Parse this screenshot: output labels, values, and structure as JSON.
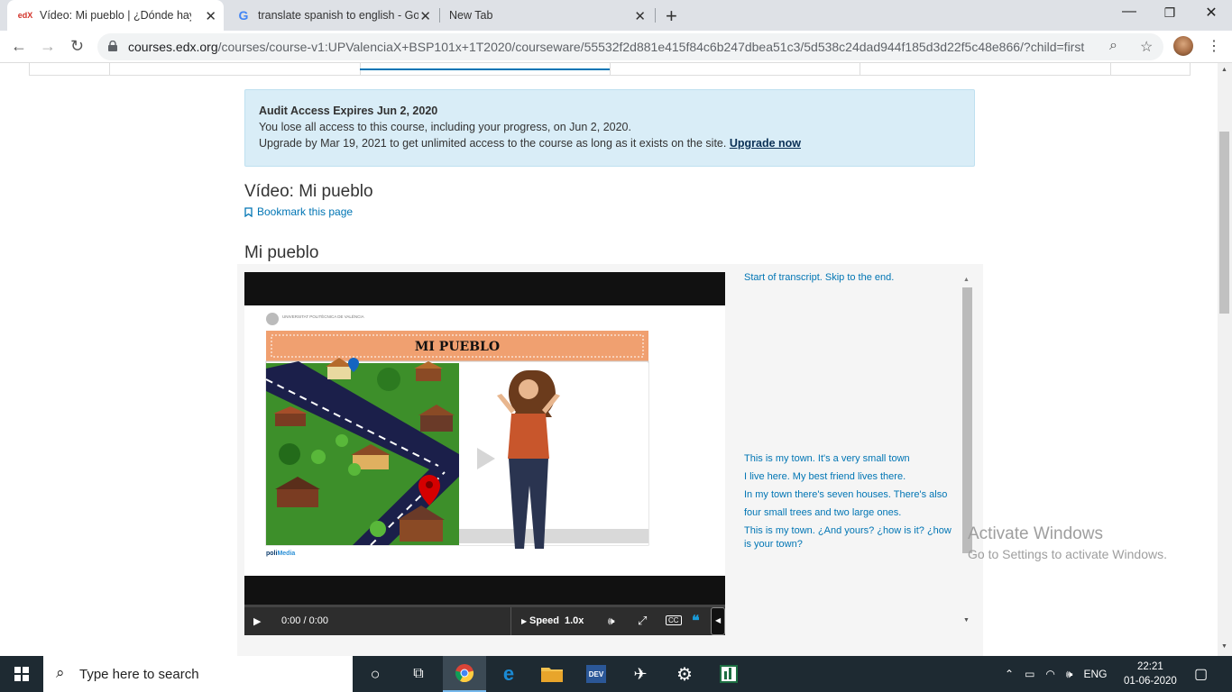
{
  "browser": {
    "tabs": [
      {
        "title": "Vídeo: Mi pueblo | ¿Dónde hay u",
        "favicon": "edx-icon",
        "favicon_text": "edX"
      },
      {
        "title": "translate spanish to english - Goo",
        "favicon": "google-icon",
        "favicon_text": "G"
      },
      {
        "title": "New Tab"
      }
    ],
    "url_host": "courses.edx.org",
    "url_path": "/courses/course-v1:UPValenciaX+BSP101x+1T2020/courseware/55532f2d881e415f84c6b247dbea51c3/5d538c24dad944f185d3d22f5c48e866/?child=first"
  },
  "notice": {
    "heading": "Audit Access Expires Jun 2, 2020",
    "line1": "You lose all access to this course, including your progress, on Jun 2, 2020.",
    "line2": "Upgrade by Mar 19, 2021 to get unlimited access to the course as long as it exists on the site.",
    "link": "Upgrade now"
  },
  "unit": {
    "title": "Vídeo: Mi pueblo",
    "bookmark": "Bookmark this page",
    "video_title": "Mi pueblo"
  },
  "video": {
    "slide_title": "MI PUEBLO",
    "logo_text": "UNIVERSITAT POLITÈCNICA DE VALÈNCIA",
    "brand_prefix": "poli",
    "brand_suffix": "Media",
    "time": "0:00 / 0:00",
    "speed_label": "Speed",
    "speed_value": "1.0x",
    "cc_label": "CC"
  },
  "transcript": {
    "start": "Start of transcript. Skip to the end.",
    "lines": [
      "This is my town. It's a very small town",
      "I live here. My best friend lives there.",
      "In my town there's seven houses. There's also",
      "four small trees and two large ones.",
      "This is my town. ¿And yours? ¿how is it? ¿how is your town?"
    ]
  },
  "watermark": {
    "line1": "Activate Windows",
    "line2": "Go to Settings to activate Windows."
  },
  "taskbar": {
    "search_placeholder": "Type here to search",
    "lang": "ENG",
    "time": "22:21",
    "date": "01-06-2020"
  }
}
